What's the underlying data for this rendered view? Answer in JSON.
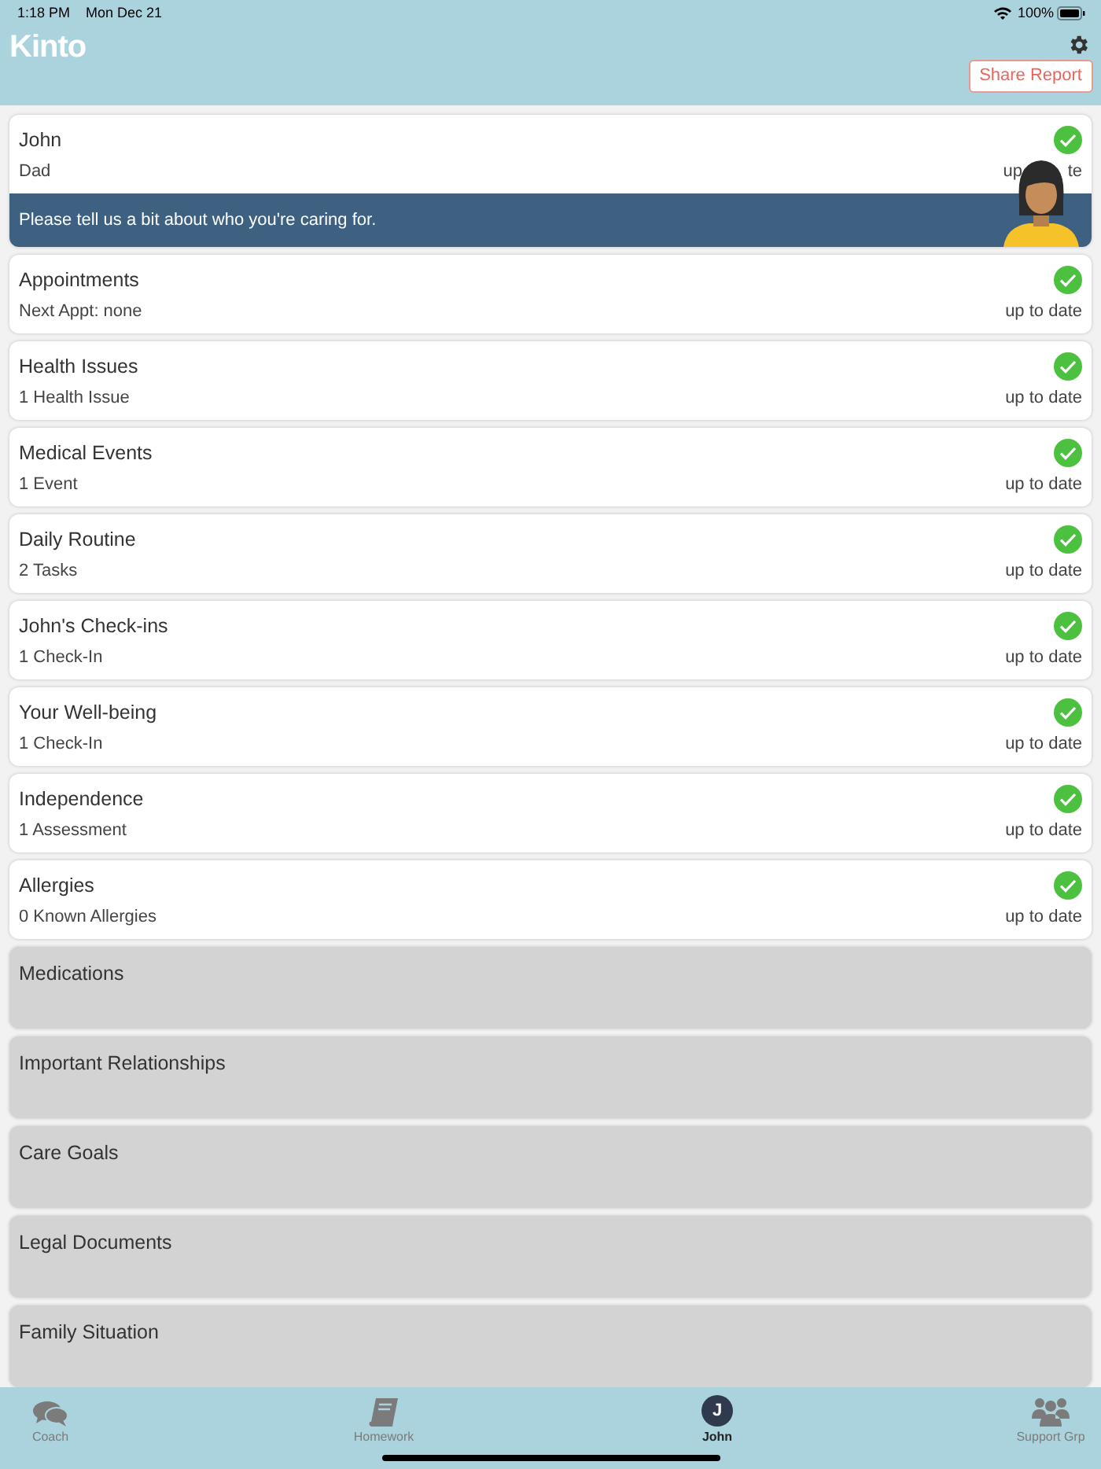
{
  "status_bar": {
    "time": "1:18 PM",
    "date": "Mon Dec 21",
    "battery": "100%"
  },
  "header": {
    "logo": "Kinto",
    "share_button": "Share Report"
  },
  "profile": {
    "name": "John",
    "relation": "Dad",
    "status_parts": [
      "up",
      "te"
    ],
    "complete": true,
    "coach_message": "Please tell us a bit about who you're caring for."
  },
  "sections": [
    {
      "title": "Appointments",
      "detail": "Next Appt: none",
      "status": "up to date",
      "complete": true
    },
    {
      "title": "Health Issues",
      "detail": "1 Health Issue",
      "status": "up to date",
      "complete": true
    },
    {
      "title": "Medical Events",
      "detail": "1 Event",
      "status": "up to date",
      "complete": true
    },
    {
      "title": "Daily Routine",
      "detail": "2 Tasks",
      "status": "up to date",
      "complete": true
    },
    {
      "title": "John's Check-ins",
      "detail": "1 Check-In",
      "status": "up to date",
      "complete": true
    },
    {
      "title": "Your Well-being",
      "detail": "1 Check-In",
      "status": "up to date",
      "complete": true
    },
    {
      "title": "Independence",
      "detail": "1 Assessment",
      "status": "up to date",
      "complete": true
    },
    {
      "title": "Allergies",
      "detail": "0 Known Allergies",
      "status": "up to date",
      "complete": true
    },
    {
      "title": "Medications",
      "complete": false
    },
    {
      "title": "Important Relationships",
      "complete": false
    },
    {
      "title": "Care Goals",
      "complete": false
    },
    {
      "title": "Legal Documents",
      "complete": false
    },
    {
      "title": "Family Situation",
      "complete": false
    }
  ],
  "tab_bar": [
    {
      "kind": "chat",
      "label": "Coach",
      "selected": false
    },
    {
      "kind": "book",
      "label": "Homework",
      "selected": false
    },
    {
      "kind": "avatar",
      "initial": "J",
      "label": "John",
      "selected": true
    },
    {
      "kind": "group",
      "label": "Support Grp",
      "selected": false
    }
  ]
}
